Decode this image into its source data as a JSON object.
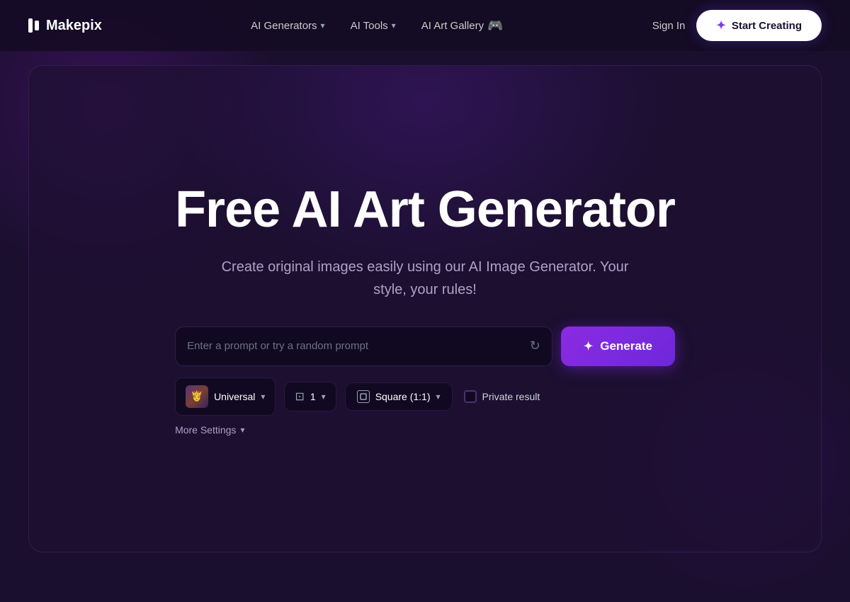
{
  "brand": {
    "name": "Makepix"
  },
  "nav": {
    "links": [
      {
        "label": "AI Generators",
        "hasDropdown": true,
        "id": "ai-generators"
      },
      {
        "label": "AI Tools",
        "hasDropdown": true,
        "id": "ai-tools"
      },
      {
        "label": "AI Art Gallery",
        "hasDiscord": true,
        "id": "ai-art-gallery"
      }
    ],
    "sign_in_label": "Sign In",
    "start_creating_label": "Start Creating"
  },
  "hero": {
    "title": "Free AI Art Generator",
    "subtitle": "Create original images easily using our AI Image Generator. Your style, your rules!"
  },
  "prompt": {
    "placeholder": "Enter a prompt or try a random prompt"
  },
  "generate_button": {
    "label": "Generate"
  },
  "settings": {
    "model": {
      "name": "Universal"
    },
    "count": {
      "value": "1"
    },
    "aspect": {
      "label": "Square (1:1)"
    },
    "private_result_label": "Private result"
  },
  "more_settings_label": "More Settings"
}
